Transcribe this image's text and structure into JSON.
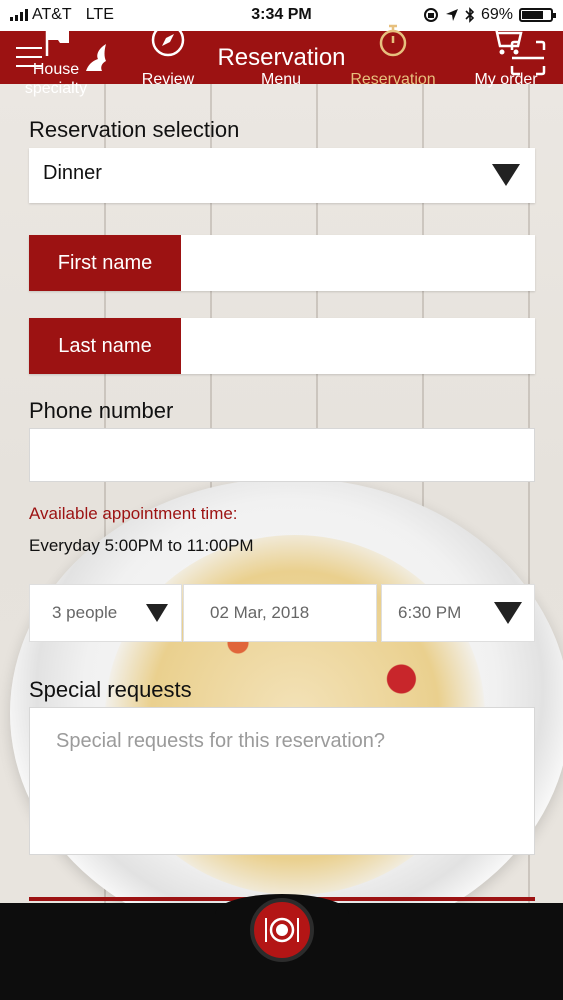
{
  "status_bar": {
    "carrier": "AT&T",
    "network": "LTE",
    "time": "3:34 PM",
    "battery": "69%"
  },
  "header": {
    "title": "Reservation"
  },
  "form": {
    "reservation_selection_label": "Reservation selection",
    "reservation_selection_value": "Dinner",
    "first_name_label": "First name",
    "first_name_value": "",
    "last_name_label": "Last name",
    "last_name_value": "",
    "phone_label": "Phone number",
    "phone_value": "",
    "availability_label": "Available appointment time:",
    "availability_hours": "Everyday 5:00PM to 11:00PM",
    "party_size": "3 people",
    "date": "02 Mar, 2018",
    "time": "6:30 PM",
    "special_requests_label": "Special requests",
    "special_requests_placeholder": "Special requests for this reservation?"
  },
  "tab_bar": {
    "items": [
      {
        "label": "House\nspecialty",
        "icon": "flag-icon",
        "active": false
      },
      {
        "label": "Review",
        "icon": "compass-icon",
        "active": false
      },
      {
        "label": "Menu",
        "icon": "plate-cutlery-icon",
        "active": false
      },
      {
        "label": "Reservation",
        "icon": "stopwatch-icon",
        "active": true
      },
      {
        "label": "My order",
        "icon": "cart-icon",
        "active": false
      }
    ]
  },
  "colors": {
    "brand_red": "#9c1212",
    "active_tab": "#e7c07e",
    "tab_bar_bg": "#0d0d0d"
  }
}
